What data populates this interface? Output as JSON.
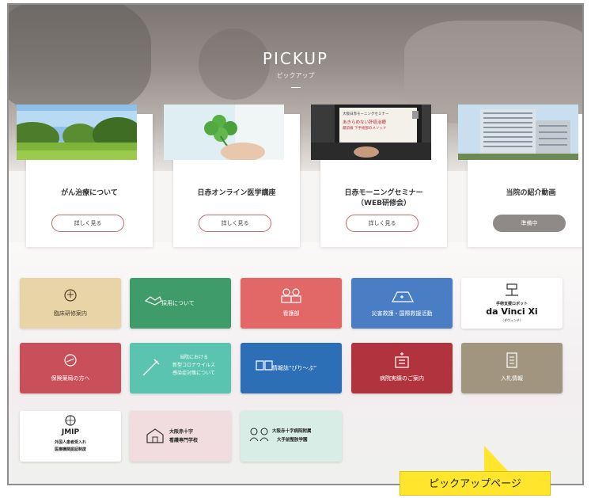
{
  "header": {
    "title": "PICKUP",
    "subtitle": "ピックアップ"
  },
  "cards": [
    {
      "title": "がん治療について",
      "button": "詳しく見る"
    },
    {
      "title": "日赤オンライン医学講座",
      "button": "詳しく見る"
    },
    {
      "title_line1": "日赤モーニングセミナー",
      "title_line2": "（WEB研修会）",
      "button": "詳しく見る",
      "photo_text1": "大阪日赤モーニングセミナー",
      "photo_text2": "あきらめない肝癌治療",
      "photo_text3": "最前線 下手術部のメソッド"
    },
    {
      "title": "当院の紹介動画",
      "button": "準備中"
    }
  ],
  "tiles_row1": [
    {
      "label": "臨床研修案内",
      "color": "#e8d4a6"
    },
    {
      "label": "採用について",
      "color": "#3f9b6a"
    },
    {
      "label": "看護部",
      "color": "#e26767"
    },
    {
      "label": "災害救護・国際救援活動",
      "color": "#4a7ec4"
    },
    {
      "label_small": "手術支援ロボット",
      "label_big": "da Vinci Xi",
      "label_kana": "（ダヴィンチ）"
    }
  ],
  "tiles_row2": [
    {
      "label": "保険薬局の方へ",
      "color": "#c9505a"
    },
    {
      "label_line1": "当院における",
      "label_line2": "新型コロナウイルス",
      "label_line3": "感染症対策について",
      "color": "#5bc4b0"
    },
    {
      "label": "情報誌“ぴり〜ぷ”",
      "color": "#2d6fb6"
    },
    {
      "label": "病院実績のご案内",
      "color": "#b1333e"
    },
    {
      "label": "入札情報",
      "color": "#a19580"
    }
  ],
  "tiles_row3": [
    {
      "label_big": "JMIP",
      "label_line1": "外国人患者受入れ",
      "label_line2": "医療機関認証制度"
    },
    {
      "label_line1": "大阪赤十字",
      "label_line2": "看護専門学校"
    },
    {
      "label_line1": "大阪赤十字病院附属",
      "label_line2": "大手前整肢学園"
    }
  ],
  "callout": "ピックアップページ"
}
